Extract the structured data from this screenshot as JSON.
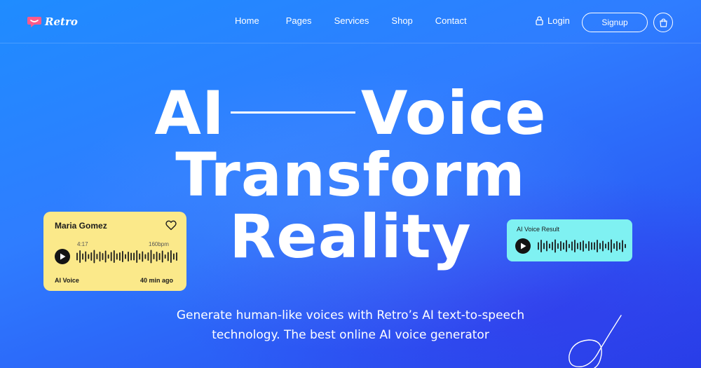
{
  "nav": {
    "brand": "Retro",
    "links": [
      "Home",
      "Pages",
      "Services",
      "Shop",
      "Contact"
    ],
    "login_label": "Login",
    "signup_label": "Signup",
    "icons": {
      "logo": "chat-bubble-icon",
      "login": "lock-icon",
      "cart": "shopping-bag-icon"
    }
  },
  "hero": {
    "line1_left": "AI",
    "line1_right": "Voice",
    "line2": "Transform",
    "line3": "Reality",
    "subtitle_line1": "Generate human-like voices with Retro’s AI text-to-speech",
    "subtitle_line2": "technology. The best online AI voice generator"
  },
  "voice_card": {
    "name": "Maria Gomez",
    "duration": "4:17",
    "tempo": "160bpm",
    "label": "AI Voice",
    "time_ago": "40 min ago",
    "background": "#fbe98a"
  },
  "result_card": {
    "title": "AI Voice Result",
    "background": "#7ff1f2"
  },
  "colors": {
    "accent": "#ff5a8a",
    "background_start": "#1f8cff",
    "background_end": "#2540e8"
  }
}
